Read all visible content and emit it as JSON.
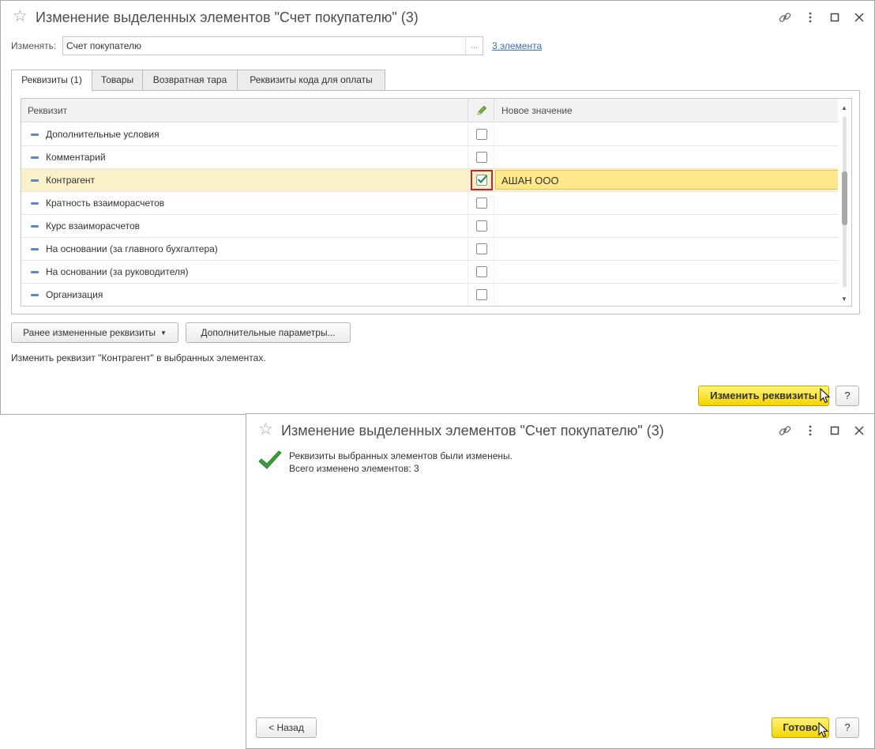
{
  "window1": {
    "title": "Изменение выделенных элементов \"Счет покупателю\" (3)",
    "change_label": "Изменять:",
    "change_value": "Счет покупателю",
    "choose_button": "...",
    "elements_link": "3 элемента",
    "tabs": [
      {
        "label": "Реквизиты (1)",
        "active": true
      },
      {
        "label": "Товары",
        "active": false
      },
      {
        "label": "Возвратная тара",
        "active": false
      },
      {
        "label": "Реквизиты кода для оплаты",
        "active": false
      }
    ],
    "grid": {
      "headers": {
        "attribute": "Реквизит",
        "edit_icon": "pencil-icon",
        "new_value": "Новое значение"
      },
      "rows": [
        {
          "name": "Дополнительные условия",
          "checked": false,
          "new_value": ""
        },
        {
          "name": "Комментарий",
          "checked": false,
          "new_value": ""
        },
        {
          "name": "Контрагент",
          "checked": true,
          "new_value": "АШАН ООО"
        },
        {
          "name": "Кратность взаиморасчетов",
          "checked": false,
          "new_value": ""
        },
        {
          "name": "Курс взаиморасчетов",
          "checked": false,
          "new_value": ""
        },
        {
          "name": "На основании (за главного бухгалтера)",
          "checked": false,
          "new_value": ""
        },
        {
          "name": "На основании (за руководителя)",
          "checked": false,
          "new_value": ""
        },
        {
          "name": "Организация",
          "checked": false,
          "new_value": ""
        }
      ]
    },
    "prev_changed_button": "Ранее измененные реквизиты",
    "extra_params_button": "Дополнительные параметры...",
    "status_text": "Изменить реквизит \"Контрагент\" в выбранных элементах.",
    "change_button": "Изменить реквизиты",
    "help_button": "?"
  },
  "window2": {
    "title": "Изменение выделенных элементов \"Счет покупателю\" (3)",
    "message_line1": "Реквизиты выбранных элементов были изменены.",
    "message_line2": "Всего изменено элементов: 3",
    "back_button": "< Назад",
    "done_button": "Готово",
    "help_button": "?"
  },
  "colors": {
    "accent_yellow": "#f2d400",
    "selected_row": "#fbf1c8",
    "value_highlight": "#ffe88a",
    "link_blue": "#3b6fb6",
    "success_green": "#3aa13a",
    "highlight_frame": "#c0282d"
  }
}
